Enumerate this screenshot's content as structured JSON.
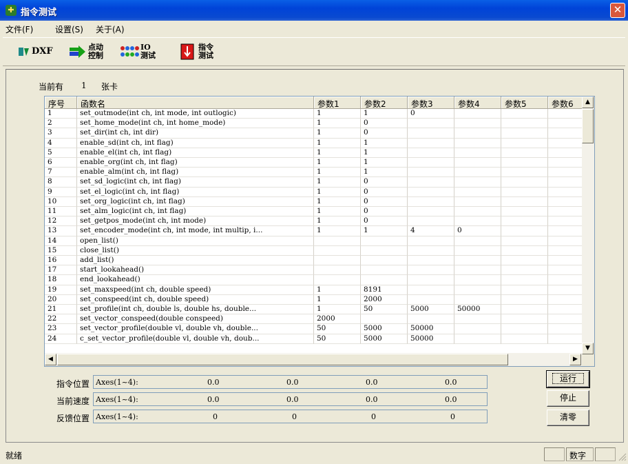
{
  "window": {
    "title": "指令测试",
    "close_glyph": "✕"
  },
  "menu": [
    {
      "label": "文件(F)"
    },
    {
      "label": "设置(S)"
    },
    {
      "label": "关于(A)"
    }
  ],
  "toolbar": {
    "dxf_label": "DXF",
    "jog_label_1": "点动",
    "jog_label_2": "控制",
    "io_label_1": "IO",
    "io_label_2": "测试",
    "cmd_label_1": "指令",
    "cmd_label_2": "测试"
  },
  "card_info": {
    "prefix": "当前有",
    "count": "1",
    "suffix": "张卡"
  },
  "grid": {
    "columns": [
      "序号",
      "函数名",
      "参数1",
      "参数2",
      "参数3",
      "参数4",
      "参数5",
      "参数6"
    ],
    "rows": [
      [
        "1",
        "set_outmode(int ch, int mode, int outlogic)",
        "1",
        "1",
        "0",
        "",
        "",
        ""
      ],
      [
        "2",
        "set_home_mode(int ch, int home_mode)",
        "1",
        "0",
        "",
        "",
        "",
        ""
      ],
      [
        "3",
        "set_dir(int ch, int dir)",
        "1",
        "0",
        "",
        "",
        "",
        ""
      ],
      [
        "4",
        "enable_sd(int ch, int flag)",
        "1",
        "1",
        "",
        "",
        "",
        ""
      ],
      [
        "5",
        "enable_el(int ch, int flag)",
        "1",
        "1",
        "",
        "",
        "",
        ""
      ],
      [
        "6",
        "enable_org(int ch, int flag)",
        "1",
        "1",
        "",
        "",
        "",
        ""
      ],
      [
        "7",
        "enable_alm(int ch, int flag)",
        "1",
        "1",
        "",
        "",
        "",
        ""
      ],
      [
        "8",
        "set_sd_logic(int ch, int flag)",
        "1",
        "0",
        "",
        "",
        "",
        ""
      ],
      [
        "9",
        "set_el_logic(int ch, int flag)",
        "1",
        "0",
        "",
        "",
        "",
        ""
      ],
      [
        "10",
        "set_org_logic(int ch, int flag)",
        "1",
        "0",
        "",
        "",
        "",
        ""
      ],
      [
        "11",
        "set_alm_logic(int ch, int flag)",
        "1",
        "0",
        "",
        "",
        "",
        ""
      ],
      [
        "12",
        "set_getpos_mode(int ch, int mode)",
        "1",
        "0",
        "",
        "",
        "",
        ""
      ],
      [
        "13",
        "set_encoder_mode(int ch, int mode, int multip, i...",
        "1",
        "1",
        "4",
        "0",
        "",
        ""
      ],
      [
        "14",
        "open_list()",
        "",
        "",
        "",
        "",
        "",
        ""
      ],
      [
        "15",
        "close_list()",
        "",
        "",
        "",
        "",
        "",
        ""
      ],
      [
        "16",
        "add_list()",
        "",
        "",
        "",
        "",
        "",
        ""
      ],
      [
        "17",
        "start_lookahead()",
        "",
        "",
        "",
        "",
        "",
        ""
      ],
      [
        "18",
        "end_lookahead()",
        "",
        "",
        "",
        "",
        "",
        ""
      ],
      [
        "19",
        "set_maxspeed(int ch, double speed)",
        "1",
        "8191",
        "",
        "",
        "",
        ""
      ],
      [
        "20",
        "set_conspeed(int ch, double speed)",
        "1",
        "2000",
        "",
        "",
        "",
        ""
      ],
      [
        "21",
        "set_profile(int ch, double ls, double hs, double...",
        "1",
        "50",
        "5000",
        "50000",
        "",
        ""
      ],
      [
        "22",
        "set_vector_conspeed(double conspeed)",
        "2000",
        "",
        "",
        "",
        "",
        ""
      ],
      [
        "23",
        "set_vector_profile(double vl, double vh, double...",
        "50",
        "5000",
        "50000",
        "",
        "",
        ""
      ],
      [
        "24",
        "c_set_vector_profile(double vl, double vh, doub...",
        "50",
        "5000",
        "50000",
        "",
        "",
        ""
      ]
    ]
  },
  "positions": [
    {
      "label": "指令位置",
      "axes": "Axes(1~4):",
      "values": [
        "0.0",
        "0.0",
        "0.0",
        "0.0"
      ]
    },
    {
      "label": "当前速度",
      "axes": "Axes(1~4):",
      "values": [
        "0.0",
        "0.0",
        "0.0",
        "0.0"
      ]
    },
    {
      "label": "反馈位置",
      "axes": "Axes(1~4):",
      "values": [
        "0",
        "0",
        "0",
        "0"
      ]
    }
  ],
  "buttons": {
    "run": "运行",
    "stop": "停止",
    "clear": "清零"
  },
  "statusbar": {
    "ready": "就绪",
    "numlock": "数字"
  }
}
